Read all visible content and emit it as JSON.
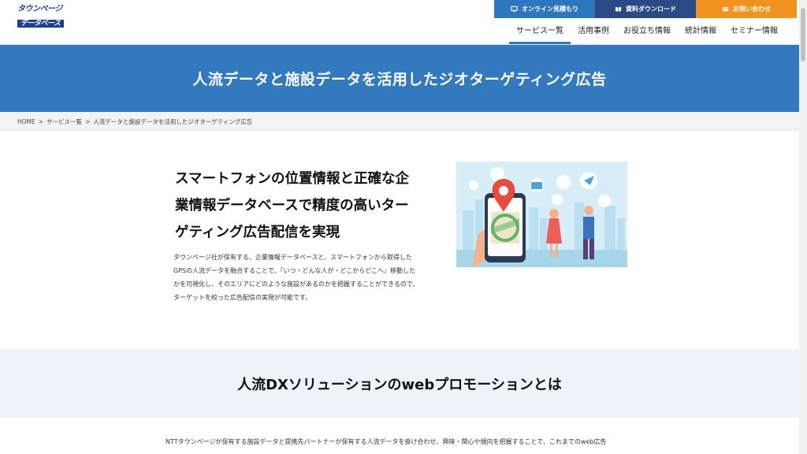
{
  "header": {
    "logo_top": "タウンページ",
    "logo_bottom": "データベース",
    "top_buttons": [
      {
        "label": "オンライン見積もり",
        "color": "#2e76bd"
      },
      {
        "label": "資料ダウンロード",
        "color": "#2a4a86"
      },
      {
        "label": "お問い合わせ",
        "color": "#f2921f"
      }
    ],
    "nav": [
      {
        "label": "サービス一覧",
        "active": true
      },
      {
        "label": "活用事例"
      },
      {
        "label": "お役立ち情報"
      },
      {
        "label": "統計情報"
      },
      {
        "label": "セミナー情報"
      }
    ]
  },
  "hero": {
    "title": "人流データと施設データを活用したジオターゲティング広告",
    "bg_color": "#3279bd"
  },
  "breadcrumb": {
    "items": [
      "HOME",
      "サービス一覧",
      "人流データと施設データを活用したジオターゲティング広告"
    ],
    "separator": ">"
  },
  "intro": {
    "heading_lines": [
      "スマートフォンの位置情報と正確な企",
      "業情報データベースで精度の高いター",
      "ゲティング広告配信を実現"
    ],
    "body_lines": [
      "タウンページ社が保有する、企業情報データベースと、スマートフォンから取得した",
      "GPSの人流データを融合することで、『いつ・どんな人が・どこからどこへ』移動した",
      "かを可視化し、そのエリアにどのような施設があるのかを把握することができるので、",
      "ターゲットを絞った広告配信の実現が可能です。"
    ]
  },
  "dx": {
    "title": "人流DXソリューションのwebプロモーションとは",
    "body_line": "NTTタウンページが保有する施設データと提携先パートナーが保有する人流データを掛け合わせ、興味・関心や傾向を把握することで、これまでのweb広告"
  }
}
